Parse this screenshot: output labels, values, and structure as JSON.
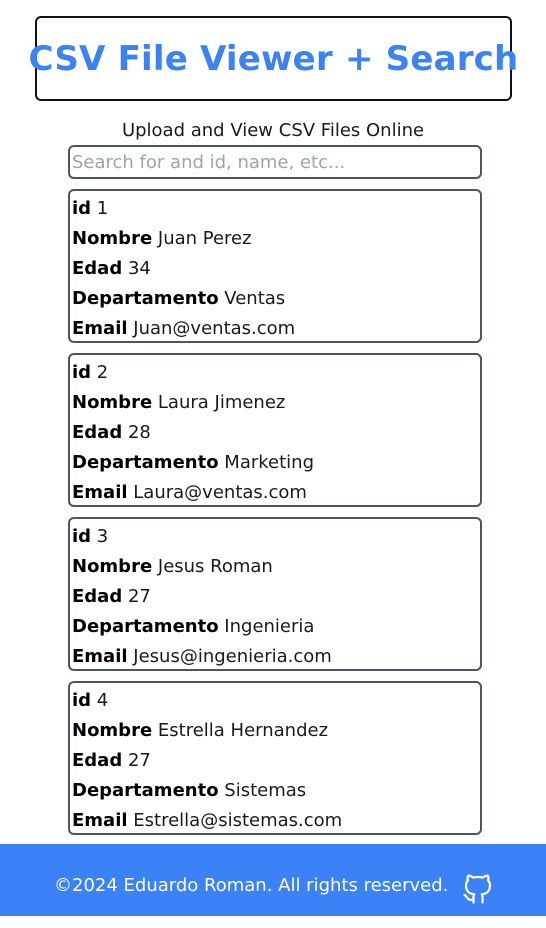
{
  "header": {
    "title": "CSV File Viewer + Search",
    "subtitle": "Upload and View CSV Files Online"
  },
  "search": {
    "placeholder": "Search for and id, name, etc...",
    "value": ""
  },
  "records": [
    {
      "fields": [
        {
          "key": "id",
          "value": "1"
        },
        {
          "key": "Nombre",
          "value": "Juan Perez"
        },
        {
          "key": "Edad",
          "value": "34"
        },
        {
          "key": "Departamento",
          "value": "Ventas"
        },
        {
          "key": "Email",
          "value": "Juan@ventas.com"
        }
      ]
    },
    {
      "fields": [
        {
          "key": "id",
          "value": "2"
        },
        {
          "key": "Nombre",
          "value": "Laura Jimenez"
        },
        {
          "key": "Edad",
          "value": "28"
        },
        {
          "key": "Departamento",
          "value": "Marketing"
        },
        {
          "key": "Email",
          "value": "Laura@ventas.com"
        }
      ]
    },
    {
      "fields": [
        {
          "key": "id",
          "value": "3"
        },
        {
          "key": "Nombre",
          "value": "Jesus Roman"
        },
        {
          "key": "Edad",
          "value": "27"
        },
        {
          "key": "Departamento",
          "value": "Ingenieria"
        },
        {
          "key": "Email",
          "value": "Jesus@ingenieria.com"
        }
      ]
    },
    {
      "fields": [
        {
          "key": "id",
          "value": "4"
        },
        {
          "key": "Nombre",
          "value": "Estrella Hernandez"
        },
        {
          "key": "Edad",
          "value": "27"
        },
        {
          "key": "Departamento",
          "value": "Sistemas"
        },
        {
          "key": "Email",
          "value": "Estrella@sistemas.com"
        }
      ]
    }
  ],
  "footer": {
    "copyright": "©2024 Eduardo Roman. All rights reserved.",
    "icon": "github-icon"
  },
  "colors": {
    "accent": "#3b82f6",
    "border": "#4b5563",
    "footer_text": "#ffffff"
  }
}
